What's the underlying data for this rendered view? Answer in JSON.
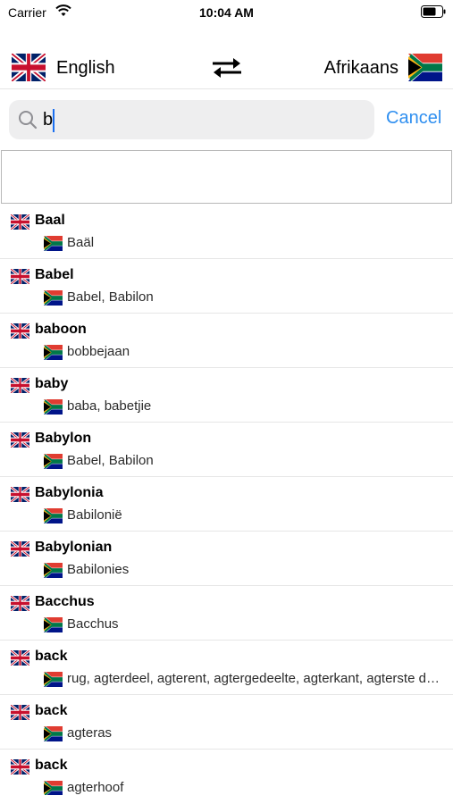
{
  "status_bar": {
    "carrier": "Carrier",
    "time": "10:04 AM"
  },
  "languages": {
    "source": {
      "label": "English",
      "flag": "uk-flag-icon"
    },
    "target": {
      "label": "Afrikaans",
      "flag": "south-africa-flag-icon"
    },
    "swap_icon": "swap-arrows-icon"
  },
  "search": {
    "value": "b",
    "placeholder": "",
    "cancel_label": "Cancel"
  },
  "colors": {
    "accent": "#2f8ff0",
    "search_bg": "#eeeeef",
    "divider": "#e6e6e6"
  },
  "results": [
    {
      "word": "Baal",
      "translation": "Baäl"
    },
    {
      "word": "Babel",
      "translation": "Babel, Babilon"
    },
    {
      "word": "baboon",
      "translation": "bobbejaan"
    },
    {
      "word": "baby",
      "translation": "baba, babetjie"
    },
    {
      "word": "Babylon",
      "translation": "Babel, Babilon"
    },
    {
      "word": "Babylonia",
      "translation": "Babilonië"
    },
    {
      "word": "Babylonian",
      "translation": "Babilonies"
    },
    {
      "word": "Bacchus",
      "translation": "Bacchus"
    },
    {
      "word": "back",
      "translation": "rug, agterdeel, agterent, agtergedeelte, agterkant, agterste deel"
    },
    {
      "word": "back",
      "translation": "agteras"
    },
    {
      "word": "back",
      "translation": "agterhoof"
    }
  ]
}
